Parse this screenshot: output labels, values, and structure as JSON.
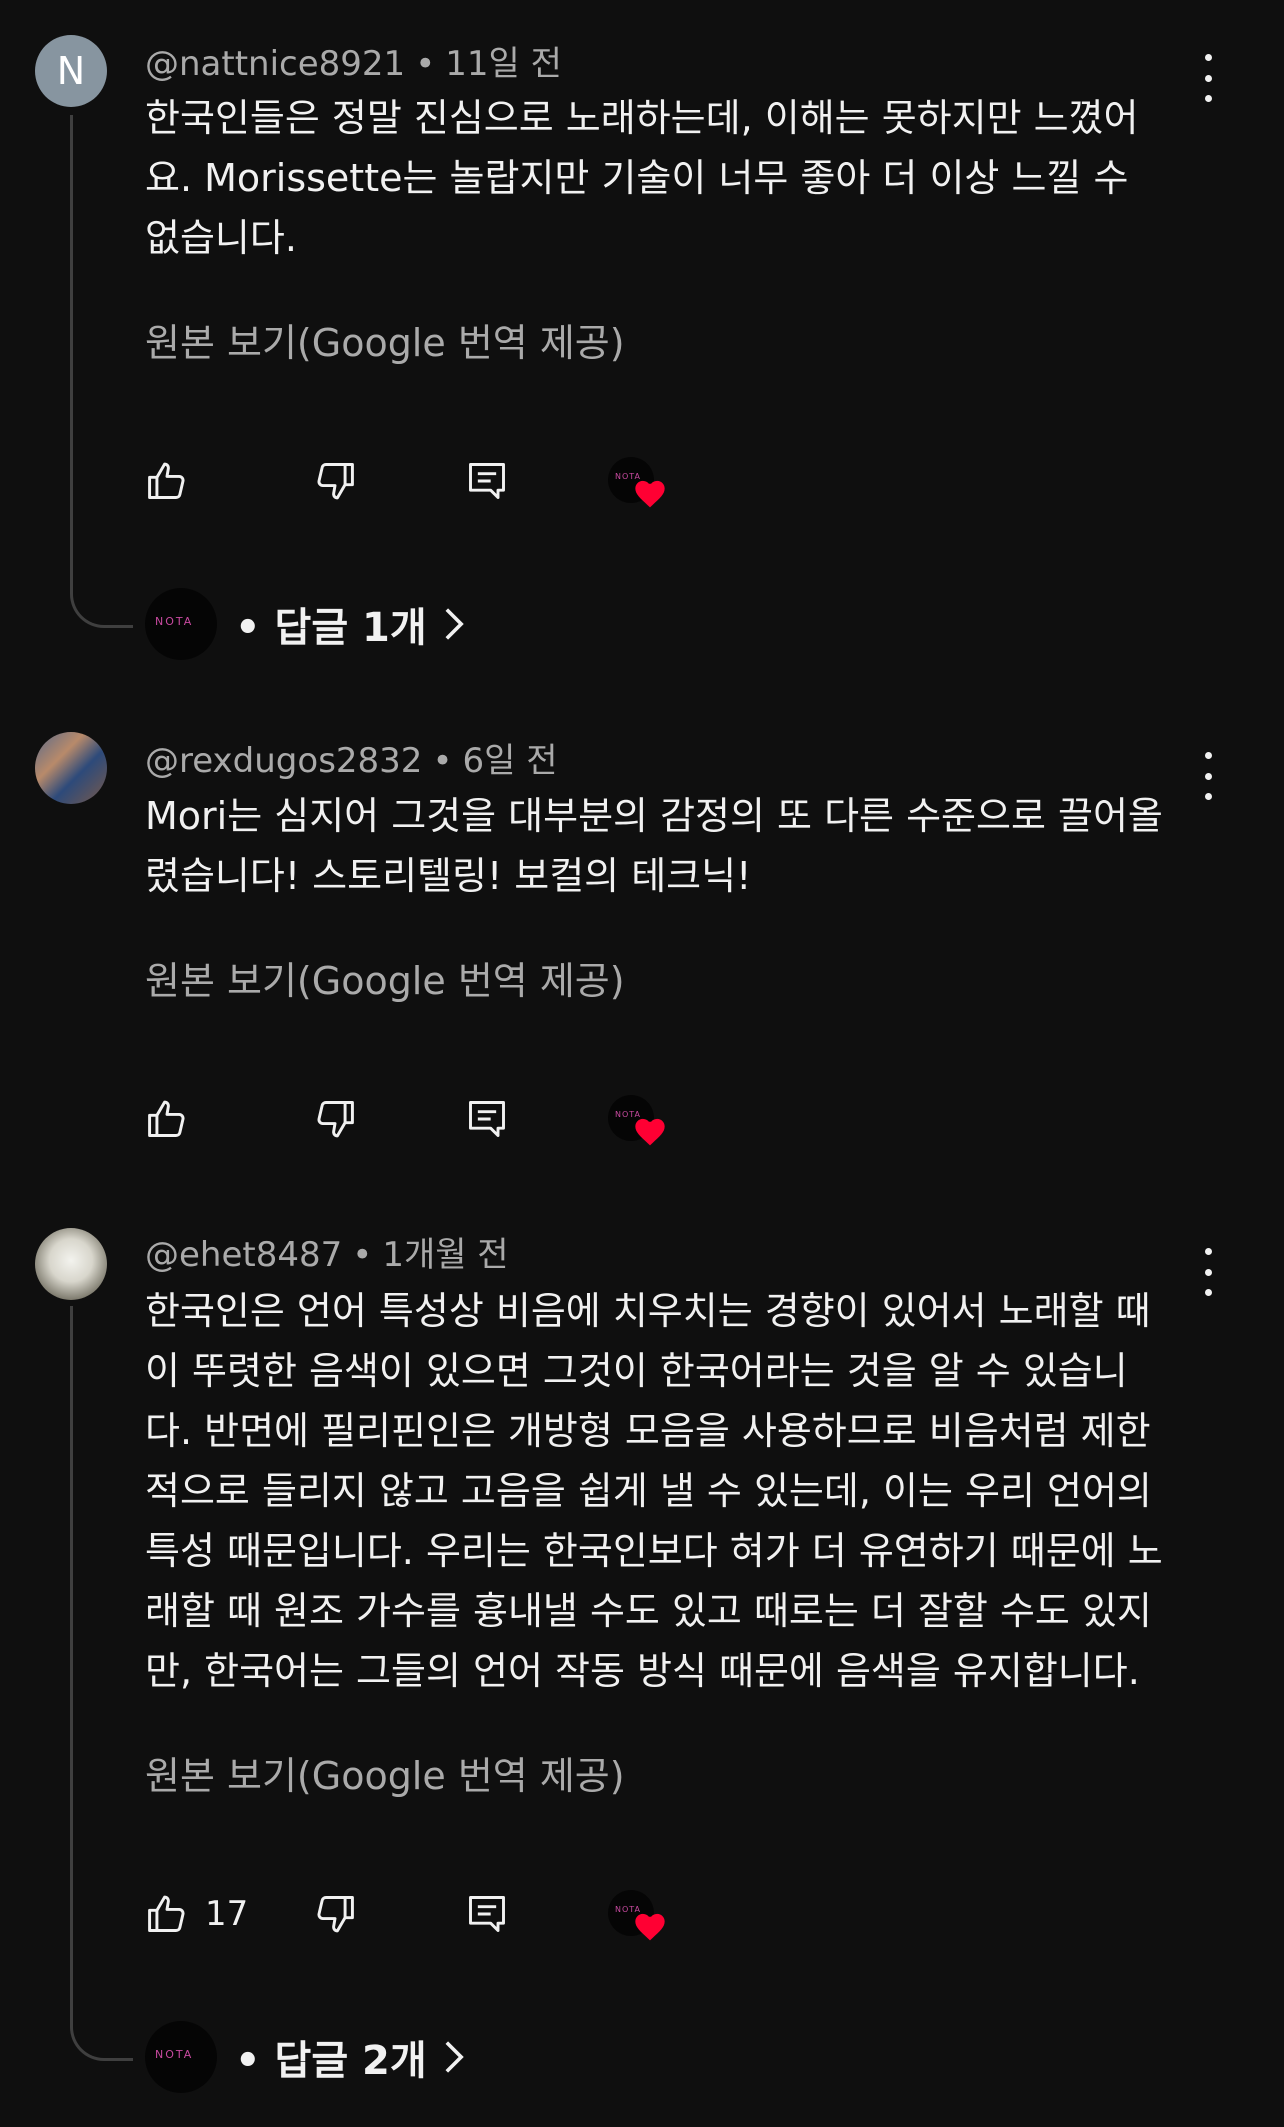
{
  "comments": [
    {
      "avatar_letter": "N",
      "handle": "@nattnice8921",
      "time": "11일 전",
      "lines": [
        "한국인들은 정말 진심으로 노래하는데, 이해는 못하지만 느꼈어",
        "요. Morissette는 놀랍지만 기술이 너무 좋아 더 이상 느낄 수",
        "없습니다."
      ],
      "translate": "원본 보기(Google 번역 제공)",
      "likes": "",
      "reply_label": "답글 1개"
    },
    {
      "handle": "@rexdugos2832",
      "time": "6일 전",
      "lines": [
        "Mori는 심지어 그것을 대부분의 감정의 또 다른 수준으로 끌어올",
        "렸습니다! 스토리텔링! 보컬의 테크닉!"
      ],
      "translate": "원본 보기(Google 번역 제공)",
      "likes": ""
    },
    {
      "handle": "@ehet8487",
      "time": "1개월 전",
      "lines": [
        "한국인은 언어 특성상 비음에 치우치는 경향이 있어서 노래할 때",
        "이 뚜렷한 음색이 있으면 그것이 한국어라는 것을 알 수 있습니",
        "다. 반면에 필리핀인은 개방형 모음을 사용하므로 비음처럼 제한",
        "적으로 들리지 않고 고음을 쉽게 낼 수 있는데, 이는 우리 언어의",
        "특성 때문입니다. 우리는 한국인보다 혀가 더 유연하기 때문에 노",
        "래할 때 원조 가수를 흉내낼 수도 있고 때로는 더 잘할 수도 있지",
        "만, 한국어는 그들의 언어 작동 방식 때문에 음색을 유지합니다."
      ],
      "translate": "원본 보기(Google 번역 제공)",
      "likes": "17",
      "reply_label": "답글 2개"
    }
  ],
  "separator": "•",
  "channel_mark": "NOTA",
  "icons": {
    "like": "thumbs-up-icon",
    "dislike": "thumbs-down-icon",
    "reply": "comment-reply-icon",
    "heart": "creator-heart-icon",
    "more": "more-vert-icon",
    "chevron": "chevron-right-icon"
  },
  "colors": {
    "background": "#0f0f0f",
    "text": "#f1f1f1",
    "secondary": "#aaaaaa",
    "heart": "#ff0033"
  }
}
